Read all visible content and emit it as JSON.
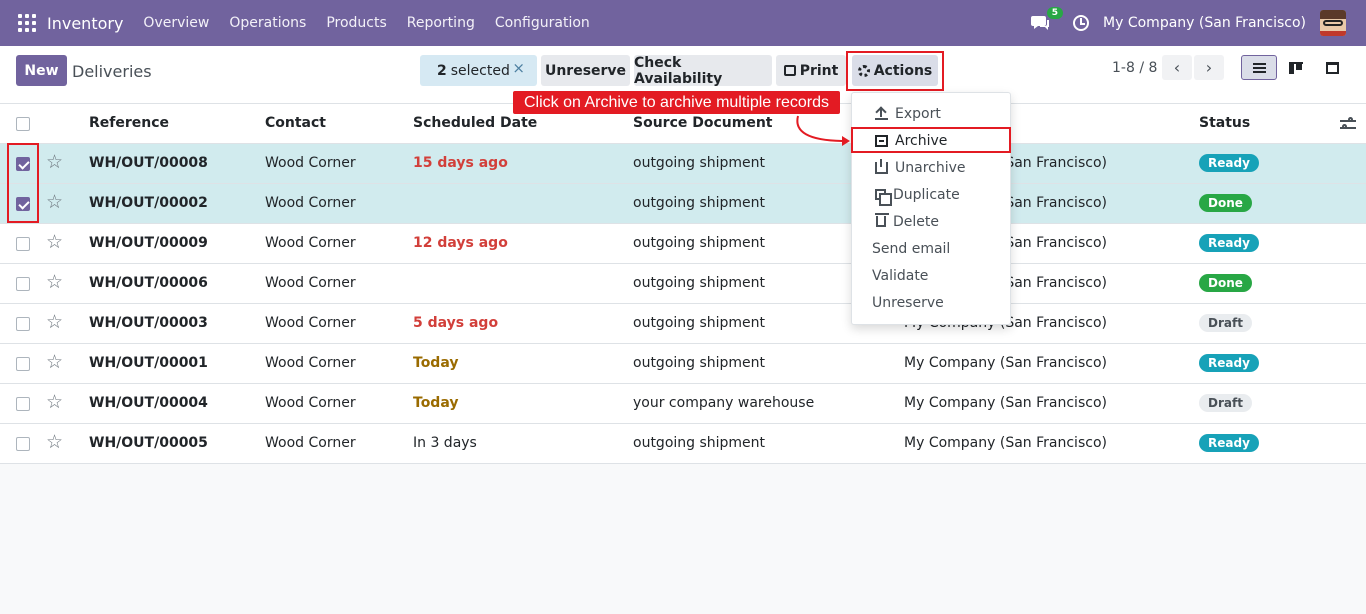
{
  "navbar": {
    "brand": "Inventory",
    "menu": [
      "Overview",
      "Operations",
      "Products",
      "Reporting",
      "Configuration"
    ],
    "chat_count": "5",
    "company": "My Company (San Francisco)"
  },
  "control": {
    "new_label": "New",
    "title": "Deliveries",
    "selected_count": "2",
    "selected_label": "selected",
    "clear_label": "×",
    "unreserve_label": "Unreserve",
    "check_label": "Check Availability",
    "print_label": "Print",
    "actions_label": "Actions",
    "pager": "1-8 / 8",
    "prev": "‹",
    "next": "›"
  },
  "columns": {
    "reference": "Reference",
    "contact": "Contact",
    "scheduled_date": "Scheduled Date",
    "source_document": "Source Document",
    "status": "Status"
  },
  "rows": [
    {
      "ref": "WH/OUT/00008",
      "contact": "Wood Corner",
      "date": "15 days ago",
      "src": "outgoing shipment",
      "company": "My Company (San Francisco)",
      "status": "Ready",
      "selected": true
    },
    {
      "ref": "WH/OUT/00002",
      "contact": "Wood Corner",
      "date": "",
      "src": "outgoing shipment",
      "company": "My Company (San Francisco)",
      "status": "Done",
      "selected": true
    },
    {
      "ref": "WH/OUT/00009",
      "contact": "Wood Corner",
      "date": "12 days ago",
      "src": "outgoing shipment",
      "company": "My Company (San Francisco)",
      "status": "Ready",
      "selected": false
    },
    {
      "ref": "WH/OUT/00006",
      "contact": "Wood Corner",
      "date": "",
      "src": "outgoing shipment",
      "company": "My Company (San Francisco)",
      "status": "Done",
      "selected": false
    },
    {
      "ref": "WH/OUT/00003",
      "contact": "Wood Corner",
      "date": "5 days ago",
      "src": "outgoing shipment",
      "company": "My Company (San Francisco)",
      "status": "Draft",
      "selected": false
    },
    {
      "ref": "WH/OUT/00001",
      "contact": "Wood Corner",
      "date": "Today",
      "src": "outgoing shipment",
      "company": "My Company (San Francisco)",
      "status": "Ready",
      "selected": false
    },
    {
      "ref": "WH/OUT/00004",
      "contact": "Wood Corner",
      "date": "Today",
      "src": "your company warehouse",
      "company": "My Company (San Francisco)",
      "status": "Draft",
      "selected": false
    },
    {
      "ref": "WH/OUT/00005",
      "contact": "Wood Corner",
      "date": "In 3 days",
      "src": "outgoing shipment",
      "company": "My Company (San Francisco)",
      "status": "Ready",
      "selected": false
    }
  ],
  "actions_menu": {
    "export": "Export",
    "archive": "Archive",
    "unarchive": "Unarchive",
    "duplicate": "Duplicate",
    "delete": "Delete",
    "send_email": "Send email",
    "validate": "Validate",
    "unreserve": "Unreserve"
  },
  "annotation": {
    "text": "Click on Archive to archive multiple records"
  },
  "colors": {
    "brand": "#71639e",
    "highlight": "#e31b23",
    "ready": "#17a2b8",
    "done": "#28a745",
    "overdue": "#d23f3a",
    "today": "#9a6b00"
  }
}
